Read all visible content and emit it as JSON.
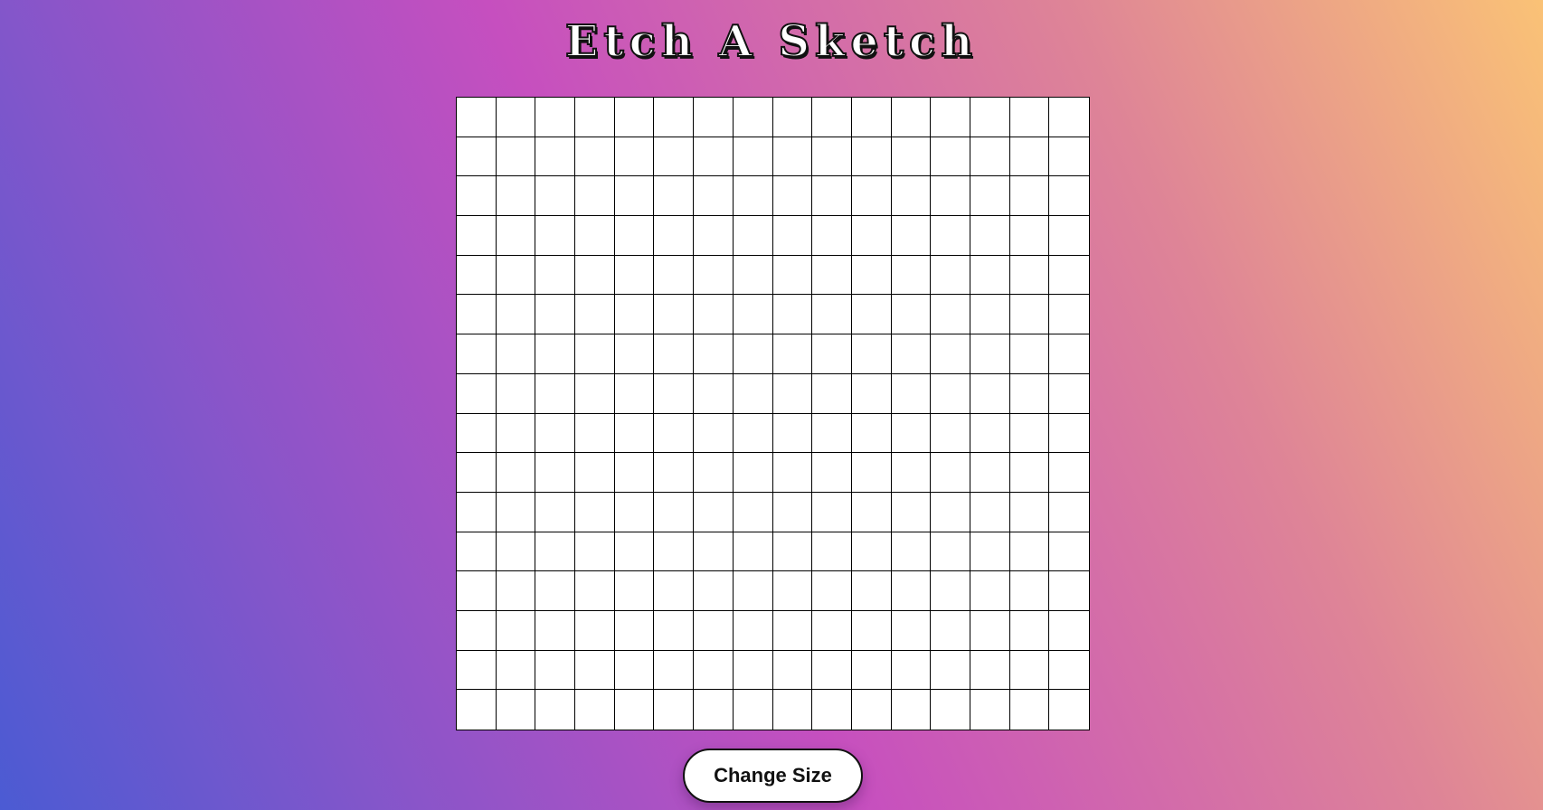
{
  "header": {
    "title": "Etch A Sketch"
  },
  "grid": {
    "size": 16,
    "cell_color": "#ffffff",
    "line_color": "#000000"
  },
  "controls": {
    "change_size_label": "Change Size"
  },
  "colors": {
    "gradient_start": "#4b5bd3",
    "gradient_mid": "#c64fbf",
    "gradient_end": "#fac276"
  }
}
